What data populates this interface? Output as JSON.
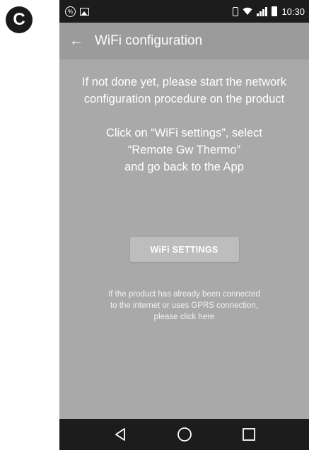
{
  "figure_badge": "C",
  "status_bar": {
    "left_icons": [
      "percent-icon",
      "image-icon"
    ],
    "right_icons": [
      "vibrate-icon",
      "wifi-icon",
      "signal-icon",
      "battery-icon"
    ],
    "percent_glyph": "%",
    "time": "10:30"
  },
  "app_bar": {
    "back_glyph": "←",
    "title": "WiFi configuration"
  },
  "content": {
    "intro_lines": [
      "If not done yet, please start the network",
      "configuration procedure on the product"
    ],
    "instruction_lines": [
      "Click on “WiFi settings”, select",
      "“Remote Gw Thermo”",
      "and go back to the App"
    ],
    "wifi_button_label": "WiFi SETTINGS",
    "note_lines": [
      "If the product has already been connected",
      "to the internet or uses GPRS connection,",
      "please click here"
    ]
  },
  "nav_bar": {
    "buttons": [
      "back-nav-icon",
      "home-nav-icon",
      "recents-nav-icon"
    ]
  },
  "colors": {
    "screen_background": "#a9a9a9",
    "app_bar": "#9b9b9b",
    "system_bars": "#1c1c1c",
    "button": "#bdbdbd",
    "text": "#ffffff"
  }
}
